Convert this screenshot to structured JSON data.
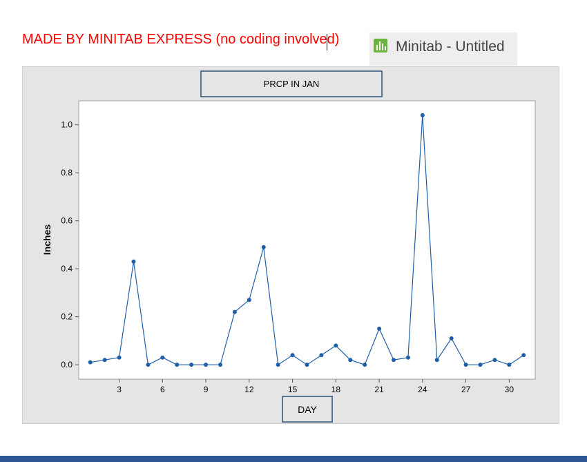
{
  "header": {
    "caption": "MADE BY MINITAB EXPRESS (no coding involved)",
    "app_title": "Minitab - Untitled",
    "app_icon": "minitab-bar-chart-icon"
  },
  "colors": {
    "caption": "#ff0000",
    "series": "#1f5fa8",
    "bottom_bar": "#2e5696",
    "frame_bg": "#e5e5e5"
  },
  "chart_data": {
    "type": "line",
    "title": "PRCP IN JAN",
    "xlabel": "DAY",
    "ylabel": "Inches",
    "xlim": [
      0.2,
      31.8
    ],
    "ylim": [
      -0.06,
      1.1
    ],
    "xticks": [
      3,
      6,
      9,
      12,
      15,
      18,
      21,
      24,
      27,
      30
    ],
    "yticks": [
      0.0,
      0.2,
      0.4,
      0.6,
      0.8,
      1.0
    ],
    "ytick_labels": [
      "0.0",
      "0.2",
      "0.4",
      "0.6",
      "0.8",
      "1.0"
    ],
    "grid": false,
    "markers": true,
    "x": [
      1,
      2,
      3,
      4,
      5,
      6,
      7,
      8,
      9,
      10,
      11,
      12,
      13,
      14,
      15,
      16,
      17,
      18,
      19,
      20,
      21,
      22,
      23,
      24,
      25,
      26,
      27,
      28,
      29,
      30,
      31
    ],
    "y": [
      0.01,
      0.02,
      0.03,
      0.43,
      0.0,
      0.03,
      0.0,
      0.0,
      0.0,
      0.0,
      0.22,
      0.27,
      0.49,
      0.0,
      0.04,
      0.0,
      0.04,
      0.08,
      0.02,
      0.0,
      0.15,
      0.02,
      0.03,
      1.04,
      0.02,
      0.11,
      0.0,
      0.0,
      0.02,
      0.0,
      0.04
    ]
  }
}
